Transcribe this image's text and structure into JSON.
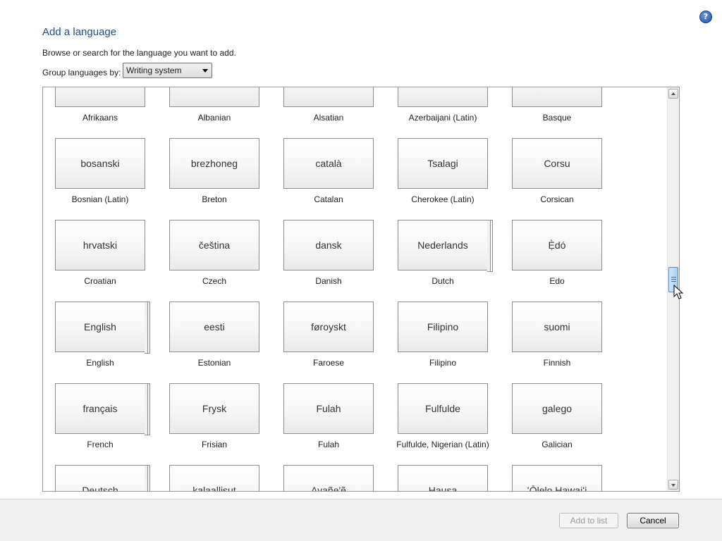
{
  "header": {
    "title": "Add a language",
    "subtitle": "Browse or search for the language you want to add.",
    "group_label": "Group languages by:",
    "group_value": "Writing system",
    "help_symbol": "?"
  },
  "languages": [
    {
      "native": "",
      "name": "Afrikaans",
      "stacked": false
    },
    {
      "native": "",
      "name": "Albanian",
      "stacked": false
    },
    {
      "native": "",
      "name": "Alsatian",
      "stacked": false
    },
    {
      "native": "",
      "name": "Azerbaijani (Latin)",
      "stacked": false
    },
    {
      "native": "",
      "name": "Basque",
      "stacked": false
    },
    {
      "native": "bosanski",
      "name": "Bosnian (Latin)",
      "stacked": false
    },
    {
      "native": "brezhoneg",
      "name": "Breton",
      "stacked": false
    },
    {
      "native": "català",
      "name": "Catalan",
      "stacked": false
    },
    {
      "native": "Tsalagi",
      "name": "Cherokee (Latin)",
      "stacked": false
    },
    {
      "native": "Corsu",
      "name": "Corsican",
      "stacked": false
    },
    {
      "native": "hrvatski",
      "name": "Croatian",
      "stacked": false
    },
    {
      "native": "čeština",
      "name": "Czech",
      "stacked": false
    },
    {
      "native": "dansk",
      "name": "Danish",
      "stacked": false
    },
    {
      "native": "Nederlands",
      "name": "Dutch",
      "stacked": true
    },
    {
      "native": "Ẹ̀dó",
      "name": "Edo",
      "stacked": false
    },
    {
      "native": "English",
      "name": "English",
      "stacked": true
    },
    {
      "native": "eesti",
      "name": "Estonian",
      "stacked": false
    },
    {
      "native": "føroyskt",
      "name": "Faroese",
      "stacked": false
    },
    {
      "native": "Filipino",
      "name": "Filipino",
      "stacked": false
    },
    {
      "native": "suomi",
      "name": "Finnish",
      "stacked": false
    },
    {
      "native": "français",
      "name": "French",
      "stacked": true
    },
    {
      "native": "Frysk",
      "name": "Frisian",
      "stacked": false
    },
    {
      "native": "Fulah",
      "name": "Fulah",
      "stacked": false
    },
    {
      "native": "Fulfulde",
      "name": "Fulfulde, Nigerian (Latin)",
      "stacked": false
    },
    {
      "native": "galego",
      "name": "Galician",
      "stacked": false
    },
    {
      "native": "Deutsch",
      "name": "",
      "stacked": true
    },
    {
      "native": "kalaallisut",
      "name": "",
      "stacked": false
    },
    {
      "native": "Avañe'ẽ",
      "name": "",
      "stacked": false
    },
    {
      "native": "Hausa",
      "name": "",
      "stacked": false
    },
    {
      "native": "ʻŌlelo Hawaiʻi",
      "name": "",
      "stacked": false
    }
  ],
  "footer": {
    "add_label": "Add to list",
    "cancel_label": "Cancel",
    "add_enabled": false
  }
}
